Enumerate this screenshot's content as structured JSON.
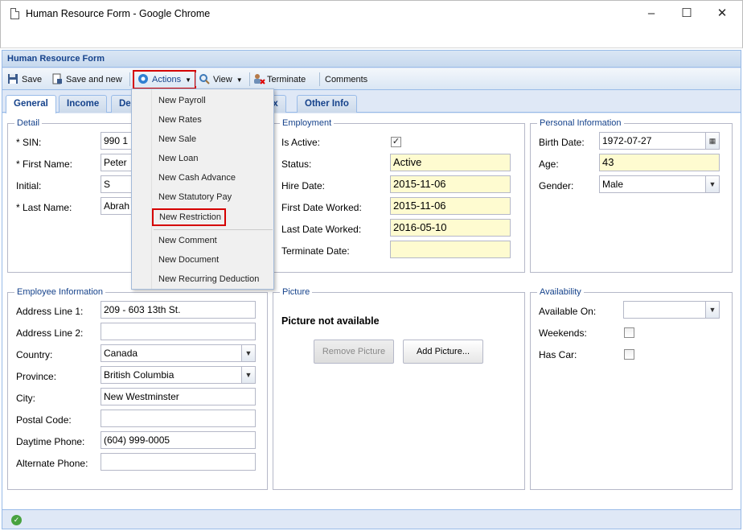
{
  "window": {
    "title": "Human Resource Form - Google Chrome"
  },
  "app": {
    "header": "Human Resource Form"
  },
  "toolbar": {
    "save": "Save",
    "save_and_new": "Save and new",
    "actions": "Actions",
    "view": "View",
    "terminate": "Terminate",
    "comments": "Comments"
  },
  "tabs": [
    {
      "label": "General"
    },
    {
      "label": "Income"
    },
    {
      "label": "Ded"
    },
    {
      "label": "ax"
    },
    {
      "label": "Other Info"
    }
  ],
  "actions_menu": {
    "items": [
      {
        "label": "New Payroll"
      },
      {
        "label": "New Rates"
      },
      {
        "label": "New Sale"
      },
      {
        "label": "New Loan"
      },
      {
        "label": "New Cash Advance"
      },
      {
        "label": "New Statutory Pay"
      },
      {
        "label": "New Restriction"
      },
      {
        "label": "New Comment"
      },
      {
        "label": "New Document"
      },
      {
        "label": "New Recurring Deduction"
      }
    ]
  },
  "detail": {
    "legend": "Detail",
    "sin_label": "* SIN:",
    "sin_value": "990 1",
    "first_name_label": "* First Name:",
    "first_name_value": "Peter",
    "initial_label": "Initial:",
    "initial_value": "S",
    "last_name_label": "* Last Name:",
    "last_name_value": "Abrah"
  },
  "employment": {
    "legend": "Employment",
    "is_active_label": "Is Active:",
    "is_active_checked": true,
    "status_label": "Status:",
    "status_value": "Active",
    "hire_date_label": "Hire Date:",
    "hire_date_value": "2015-11-06",
    "first_worked_label": "First Date Worked:",
    "first_worked_value": "2015-11-06",
    "last_worked_label": "Last Date Worked:",
    "last_worked_value": "2016-05-10",
    "terminate_label": "Terminate Date:",
    "terminate_value": ""
  },
  "personal": {
    "legend": "Personal Information",
    "birth_label": "Birth Date:",
    "birth_value": "1972-07-27",
    "age_label": "Age:",
    "age_value": "43",
    "gender_label": "Gender:",
    "gender_value": "Male"
  },
  "employee_info": {
    "legend": "Employee Information",
    "addr1_label": "Address Line 1:",
    "addr1_value": "209 - 603 13th St.",
    "addr2_label": "Address Line 2:",
    "addr2_value": "",
    "country_label": "Country:",
    "country_value": "Canada",
    "province_label": "Province:",
    "province_value": "British Columbia",
    "city_label": "City:",
    "city_value": "New Westminster",
    "postal_label": "Postal Code:",
    "postal_value": "",
    "day_phone_label": "Daytime Phone:",
    "day_phone_value": "(604) 999-0005",
    "alt_phone_label": "Alternate Phone:",
    "alt_phone_value": ""
  },
  "picture": {
    "legend": "Picture",
    "message": "Picture not available",
    "remove_button": "Remove Picture",
    "add_button": "Add Picture..."
  },
  "availability": {
    "legend": "Availability",
    "available_on_label": "Available On:",
    "available_on_value": "",
    "weekends_label": "Weekends:",
    "has_car_label": "Has Car:"
  },
  "colors": {
    "accent": "#15428b",
    "highlight": "#d50000",
    "field_yellow": "#fefbd0"
  }
}
